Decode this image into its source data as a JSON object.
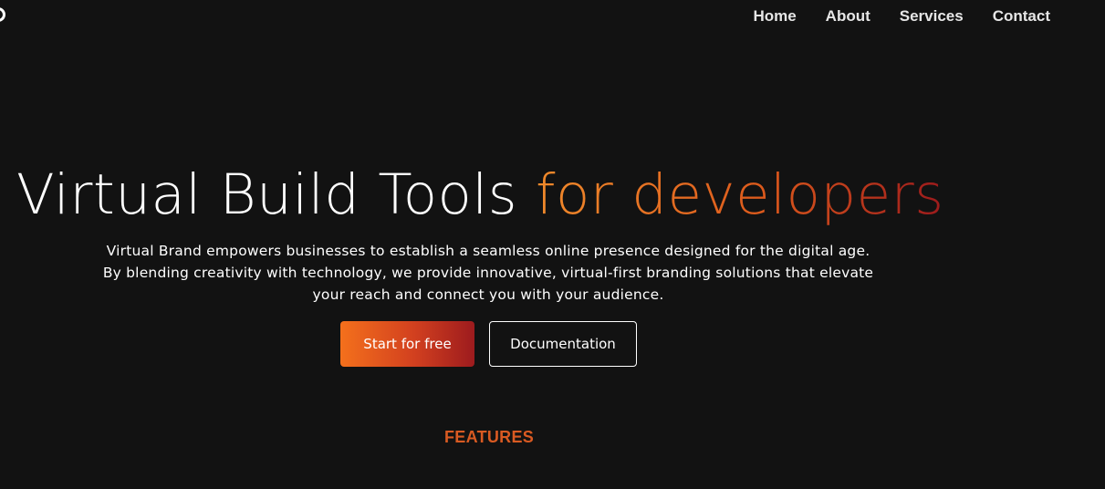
{
  "nav": {
    "items": [
      {
        "label": "Home"
      },
      {
        "label": "About"
      },
      {
        "label": "Services"
      },
      {
        "label": "Contact"
      }
    ]
  },
  "hero": {
    "title_plain": "Virtual Build Tools ",
    "title_accent": "for developers",
    "description": "Virtual Brand empowers businesses to establish a seamless online presence designed for the digital age. By blending creativity with technology, we provide innovative, virtual-first branding solutions that elevate your reach and connect you with your audience.",
    "primary_button": "Start for free",
    "secondary_button": "Documentation"
  },
  "features": {
    "heading": "FEATURES"
  },
  "colors": {
    "background": "#121212",
    "accent_start": "#f4701c",
    "accent_end": "#9d1b1e",
    "features_heading": "#d95a22"
  }
}
